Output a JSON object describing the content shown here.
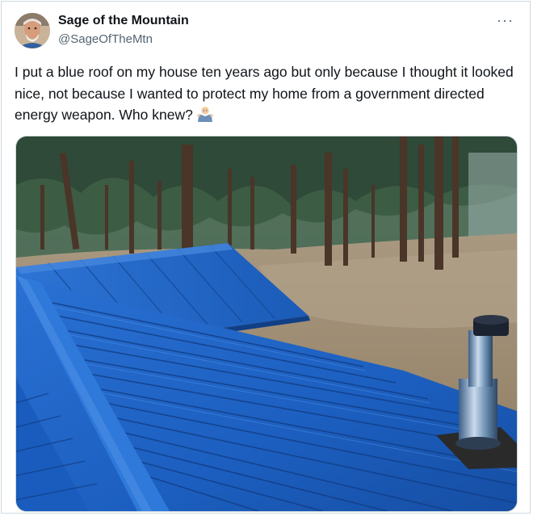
{
  "tweet": {
    "author": {
      "display_name": "Sage of the Mountain",
      "handle": "@SageOfTheMtn"
    },
    "more_label": "···",
    "text": "I put a blue roof on my house ten years ago but only because I thought it looked nice, not because I wanted to protect my home from a government directed energy weapon. Who knew?",
    "emoji": "man-shrugging-emoji",
    "media": {
      "description": "photo",
      "roof_color": "#1f63c4",
      "ground_color": "#9a8468",
      "trees_color": "#2f4a38"
    }
  },
  "colors": {
    "text": "#0f1419",
    "secondary": "#536471",
    "border": "#cfd9de"
  }
}
